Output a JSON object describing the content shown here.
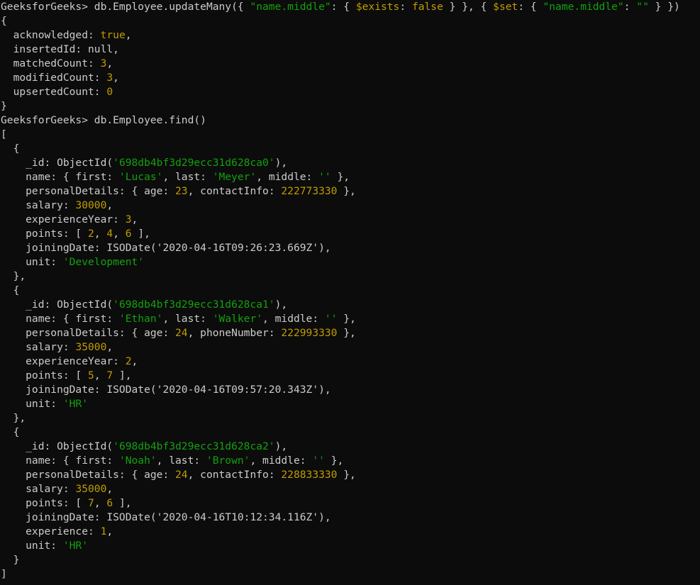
{
  "window": {
    "background": "#0c0c0c",
    "palette": {
      "default": "#cccccc",
      "string": "#13a10e",
      "number": "#c19c00",
      "bool": "#c19c00",
      "op": "#c19c00"
    }
  },
  "lines": [
    [
      [
        "default",
        "GeeksforGeeks> db.Employee.updateMany({ "
      ],
      [
        "string",
        "\"name.middle\""
      ],
      [
        "default",
        ": { "
      ],
      [
        "op",
        "$exists"
      ],
      [
        "default",
        ": "
      ],
      [
        "bool",
        "false"
      ],
      [
        "default",
        " } }, { "
      ],
      [
        "op",
        "$set"
      ],
      [
        "default",
        ": { "
      ],
      [
        "string",
        "\"name.middle\""
      ],
      [
        "default",
        ": "
      ],
      [
        "string",
        "\"\""
      ],
      [
        "default",
        " } })"
      ]
    ],
    [
      [
        "default",
        "{"
      ]
    ],
    [
      [
        "default",
        "  acknowledged: "
      ],
      [
        "bool",
        "true"
      ],
      [
        "default",
        ","
      ]
    ],
    [
      [
        "default",
        "  insertedId: null,"
      ]
    ],
    [
      [
        "default",
        "  matchedCount: "
      ],
      [
        "number",
        "3"
      ],
      [
        "default",
        ","
      ]
    ],
    [
      [
        "default",
        "  modifiedCount: "
      ],
      [
        "number",
        "3"
      ],
      [
        "default",
        ","
      ]
    ],
    [
      [
        "default",
        "  upsertedCount: "
      ],
      [
        "number",
        "0"
      ]
    ],
    [
      [
        "default",
        "}"
      ]
    ],
    [
      [
        "default",
        "GeeksforGeeks> db.Employee.find()"
      ]
    ],
    [
      [
        "default",
        "["
      ]
    ],
    [
      [
        "default",
        "  {"
      ]
    ],
    [
      [
        "default",
        "    _id: ObjectId("
      ],
      [
        "string",
        "'698db4bf3d29ecc31d628ca0'"
      ],
      [
        "default",
        "),"
      ]
    ],
    [
      [
        "default",
        "    name: { first: "
      ],
      [
        "string",
        "'Lucas'"
      ],
      [
        "default",
        ", last: "
      ],
      [
        "string",
        "'Meyer'"
      ],
      [
        "default",
        ", middle: "
      ],
      [
        "string",
        "''"
      ],
      [
        "default",
        " },"
      ]
    ],
    [
      [
        "default",
        "    personalDetails: { age: "
      ],
      [
        "number",
        "23"
      ],
      [
        "default",
        ", contactInfo: "
      ],
      [
        "number",
        "222773330"
      ],
      [
        "default",
        " },"
      ]
    ],
    [
      [
        "default",
        "    salary: "
      ],
      [
        "number",
        "30000"
      ],
      [
        "default",
        ","
      ]
    ],
    [
      [
        "default",
        "    experienceYear: "
      ],
      [
        "number",
        "3"
      ],
      [
        "default",
        ","
      ]
    ],
    [
      [
        "default",
        "    points: [ "
      ],
      [
        "number",
        "2"
      ],
      [
        "default",
        ", "
      ],
      [
        "number",
        "4"
      ],
      [
        "default",
        ", "
      ],
      [
        "number",
        "6"
      ],
      [
        "default",
        " ],"
      ]
    ],
    [
      [
        "default",
        "    joiningDate: ISODate('2020-04-16T09:26:23.669Z'),"
      ]
    ],
    [
      [
        "default",
        "    unit: "
      ],
      [
        "string",
        "'Development'"
      ]
    ],
    [
      [
        "default",
        "  },"
      ]
    ],
    [
      [
        "default",
        "  {"
      ]
    ],
    [
      [
        "default",
        "    _id: ObjectId("
      ],
      [
        "string",
        "'698db4bf3d29ecc31d628ca1'"
      ],
      [
        "default",
        "),"
      ]
    ],
    [
      [
        "default",
        "    name: { first: "
      ],
      [
        "string",
        "'Ethan'"
      ],
      [
        "default",
        ", last: "
      ],
      [
        "string",
        "'Walker'"
      ],
      [
        "default",
        ", middle: "
      ],
      [
        "string",
        "''"
      ],
      [
        "default",
        " },"
      ]
    ],
    [
      [
        "default",
        "    personalDetails: { age: "
      ],
      [
        "number",
        "24"
      ],
      [
        "default",
        ", phoneNumber: "
      ],
      [
        "number",
        "222993330"
      ],
      [
        "default",
        " },"
      ]
    ],
    [
      [
        "default",
        "    salary: "
      ],
      [
        "number",
        "35000"
      ],
      [
        "default",
        ","
      ]
    ],
    [
      [
        "default",
        "    experienceYear: "
      ],
      [
        "number",
        "2"
      ],
      [
        "default",
        ","
      ]
    ],
    [
      [
        "default",
        "    points: [ "
      ],
      [
        "number",
        "5"
      ],
      [
        "default",
        ", "
      ],
      [
        "number",
        "7"
      ],
      [
        "default",
        " ],"
      ]
    ],
    [
      [
        "default",
        "    joiningDate: ISODate('2020-04-16T09:57:20.343Z'),"
      ]
    ],
    [
      [
        "default",
        "    unit: "
      ],
      [
        "string",
        "'HR'"
      ]
    ],
    [
      [
        "default",
        "  },"
      ]
    ],
    [
      [
        "default",
        "  {"
      ]
    ],
    [
      [
        "default",
        "    _id: ObjectId("
      ],
      [
        "string",
        "'698db4bf3d29ecc31d628ca2'"
      ],
      [
        "default",
        "),"
      ]
    ],
    [
      [
        "default",
        "    name: { first: "
      ],
      [
        "string",
        "'Noah'"
      ],
      [
        "default",
        ", last: "
      ],
      [
        "string",
        "'Brown'"
      ],
      [
        "default",
        ", middle: "
      ],
      [
        "string",
        "''"
      ],
      [
        "default",
        " },"
      ]
    ],
    [
      [
        "default",
        "    personalDetails: { age: "
      ],
      [
        "number",
        "24"
      ],
      [
        "default",
        ", contactInfo: "
      ],
      [
        "number",
        "228833330"
      ],
      [
        "default",
        " },"
      ]
    ],
    [
      [
        "default",
        "    salary: "
      ],
      [
        "number",
        "35000"
      ],
      [
        "default",
        ","
      ]
    ],
    [
      [
        "default",
        "    points: [ "
      ],
      [
        "number",
        "7"
      ],
      [
        "default",
        ", "
      ],
      [
        "number",
        "6"
      ],
      [
        "default",
        " ],"
      ]
    ],
    [
      [
        "default",
        "    joiningDate: ISODate('2020-04-16T10:12:34.116Z'),"
      ]
    ],
    [
      [
        "default",
        "    experience: "
      ],
      [
        "number",
        "1"
      ],
      [
        "default",
        ","
      ]
    ],
    [
      [
        "default",
        "    unit: "
      ],
      [
        "string",
        "'HR'"
      ]
    ],
    [
      [
        "default",
        "  }"
      ]
    ],
    [
      [
        "default",
        "]"
      ]
    ]
  ]
}
